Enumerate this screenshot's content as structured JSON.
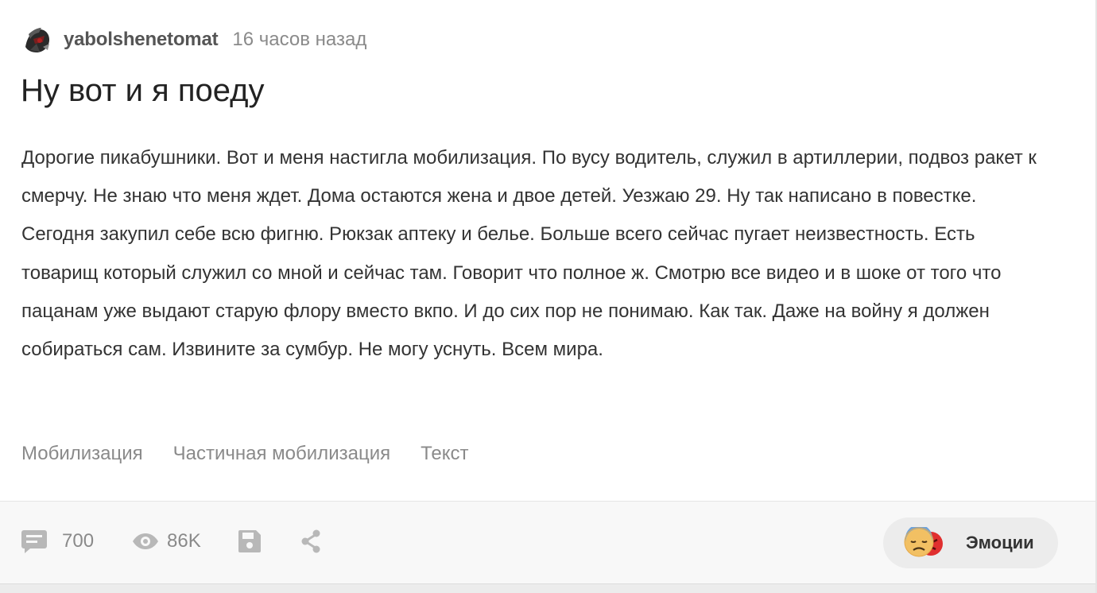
{
  "story": {
    "author": "yabolshenetomat",
    "time": "16 часов назад",
    "title": "Ну вот и я поеду",
    "paragraph": "Дорогие пикабушники. Вот и меня настигла мобилизация. По вусу водитель, служил в артиллерии, подвоз ракет к смерчу. Не знаю что меня ждет. Дома остаются жена и двое детей. Уезжаю 29. Ну так написано в повестке. Сегодня закупил себе всю фигню. Рюкзак аптеку и белье. Больше всего сейчас пугает неизвестность. Есть товарищ который служил со мной и сейчас там. Говорит что полное ж. Смотрю все видео и в шоке от того что пацанам уже выдают старую флору вместо вкпо. И до сих пор не понимаю. Как так. Даже на войну я должен собираться сам. Извините за сумбур. Не могу уснуть. Всем мира.",
    "tags": [
      "Мобилизация",
      "Частичная мобилизация",
      "Текст"
    ]
  },
  "footer": {
    "comments_count": "700",
    "views_count": "86K",
    "emotions_label": "Эмоции"
  },
  "icons": {
    "comments": "comment-icon",
    "views": "eye-icon",
    "save": "save-icon",
    "share": "share-icon",
    "emotions": [
      "sad-face-emoji",
      "angry-face-emoji"
    ]
  },
  "colors": {
    "text_primary": "#333333",
    "text_muted": "#8a8a8a",
    "icon_muted": "#b8b8b8",
    "footer_bg": "#f8f8f8",
    "button_bg": "#ececec"
  }
}
